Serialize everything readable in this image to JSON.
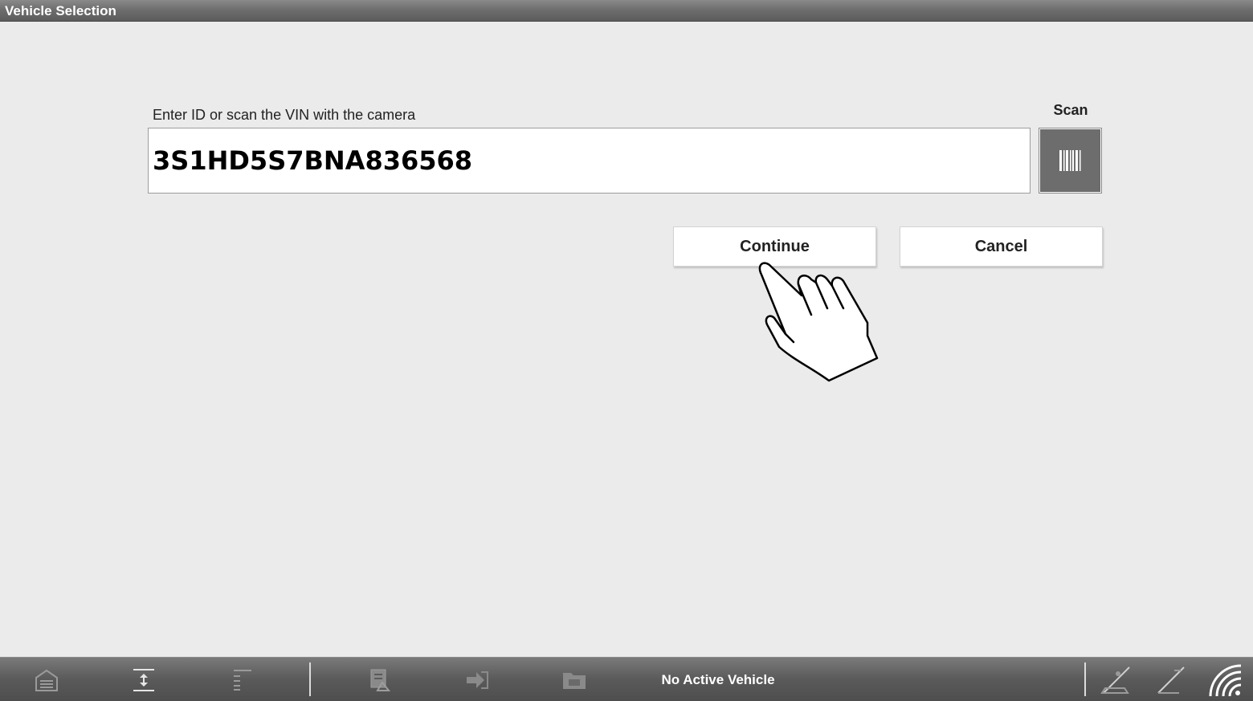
{
  "window": {
    "title": "Vehicle Selection"
  },
  "form": {
    "prompt": "Enter ID or scan the VIN with the camera",
    "vin_value": "3S1HD5S7BNA836568",
    "scan_label": "Scan"
  },
  "buttons": {
    "continue_label": "Continue",
    "cancel_label": "Cancel"
  },
  "bottom_bar": {
    "status": "No Active Vehicle",
    "tools": [
      "home-icon",
      "expand-icon",
      "list-icon",
      "report-icon",
      "exit-icon",
      "folder-icon",
      "pen-connect-icon",
      "usb-connect-icon",
      "wifi-icon"
    ]
  },
  "colors": {
    "title_bar": "#6e6e6e",
    "background": "#ebebeb",
    "scan_button": "#6d6d6d",
    "bottom_bar": "#5a5a5a"
  }
}
